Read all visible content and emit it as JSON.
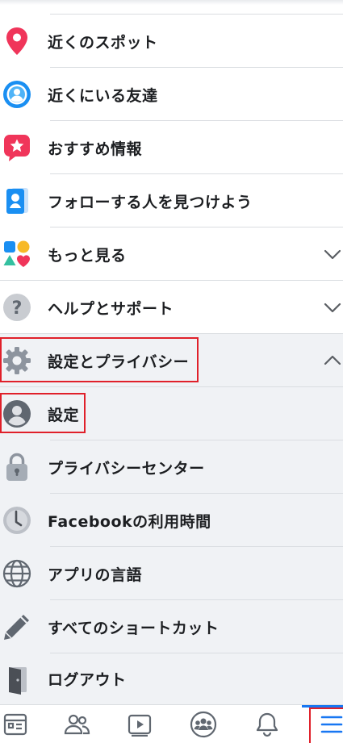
{
  "menu": {
    "items": [
      {
        "id": "nearby-spots",
        "label": "近くのスポット",
        "icon": "location-pin-icon"
      },
      {
        "id": "nearby-friends",
        "label": "近くにいる友達",
        "icon": "nearby-friends-icon"
      },
      {
        "id": "recommendations",
        "label": "おすすめ情報",
        "icon": "star-bubble-icon"
      },
      {
        "id": "find-friends",
        "label": "フォローする人を見つけよう",
        "icon": "contact-card-icon"
      },
      {
        "id": "see-more",
        "label": "もっと見る",
        "icon": "shapes-icon"
      },
      {
        "id": "help-support",
        "label": "ヘルプとサポート",
        "icon": "question-icon"
      },
      {
        "id": "settings-privacy",
        "label": "設定とプライバシー",
        "icon": "gear-icon"
      },
      {
        "id": "settings",
        "label": "設定",
        "icon": "person-icon"
      },
      {
        "id": "privacy-center",
        "label": "プライバシーセンター",
        "icon": "lock-icon"
      },
      {
        "id": "time-on-facebook",
        "label": "Facebookの利用時間",
        "icon": "clock-icon"
      },
      {
        "id": "app-language",
        "label": "アプリの言語",
        "icon": "globe-icon"
      },
      {
        "id": "all-shortcuts",
        "label": "すべてのショートカット",
        "icon": "pencil-icon"
      },
      {
        "id": "logout",
        "label": "ログアウト",
        "icon": "door-icon"
      }
    ]
  },
  "tabbar": {
    "tabs": [
      {
        "id": "news-feed",
        "icon": "news-feed-icon"
      },
      {
        "id": "friends",
        "icon": "friends-icon"
      },
      {
        "id": "watch",
        "icon": "video-play-icon"
      },
      {
        "id": "groups",
        "icon": "groups-icon"
      },
      {
        "id": "notifications",
        "icon": "bell-icon"
      },
      {
        "id": "menu",
        "icon": "hamburger-menu-icon",
        "active": true
      }
    ]
  },
  "colors": {
    "accent": "#1877f2",
    "highlight_box": "#e0202a",
    "expanded_bg": "#f0f2f5"
  }
}
